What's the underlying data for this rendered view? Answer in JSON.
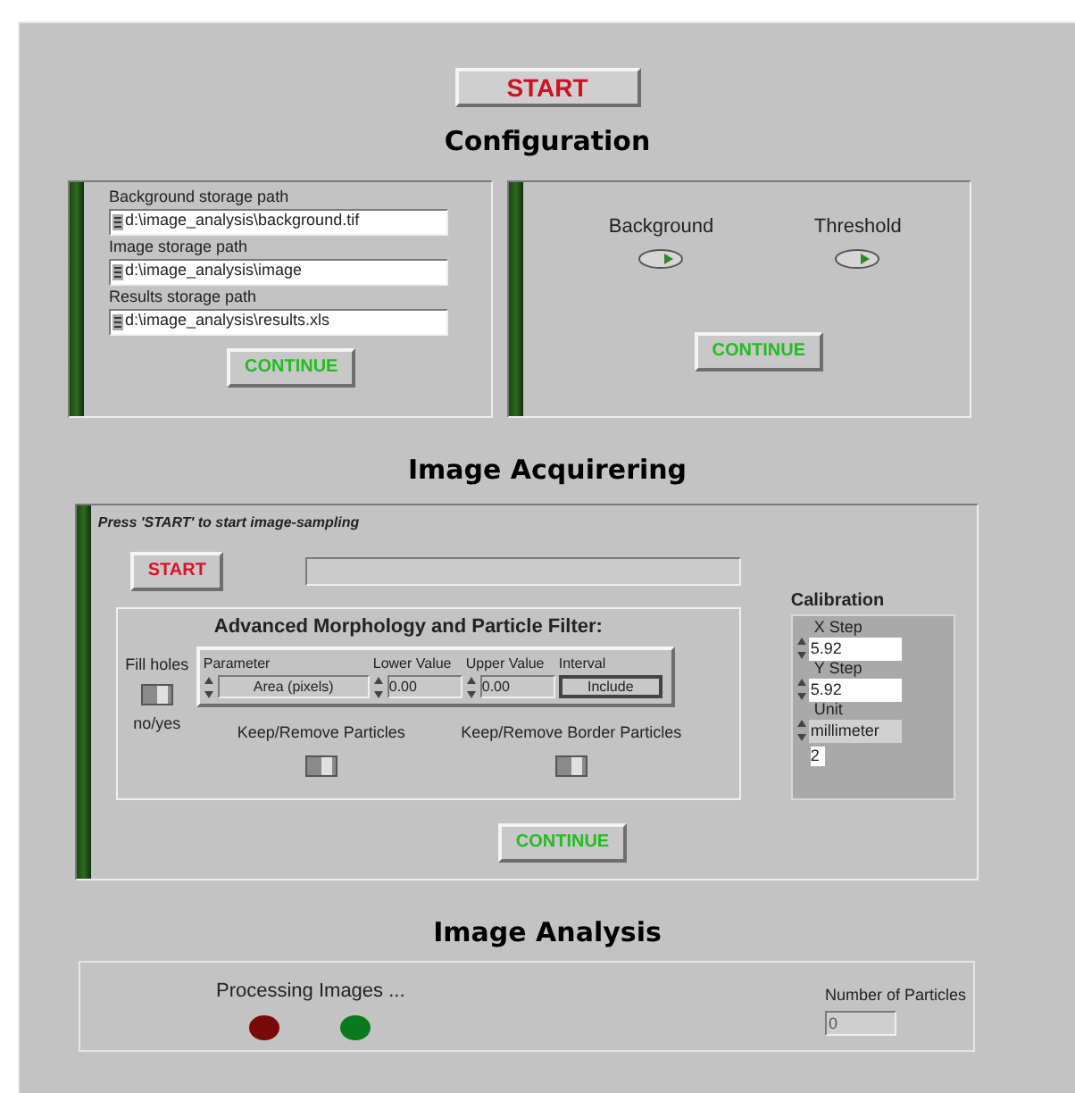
{
  "start_button": "START",
  "configuration": {
    "title": "Configuration",
    "paths": [
      {
        "label": "Background storage path",
        "value": "d:\\image_analysis\\background.tif"
      },
      {
        "label": "Image storage path",
        "value": "d:\\image_analysis\\image"
      },
      {
        "label": "Results storage path",
        "value": "d:\\image_analysis\\results.xls"
      }
    ],
    "continue_left": "CONTINUE",
    "toggles": [
      {
        "label": "Background"
      },
      {
        "label": "Threshold"
      }
    ],
    "continue_right": "CONTINUE"
  },
  "acquiring": {
    "title": "Image Acquirering",
    "hint": "Press 'START' to start image-sampling",
    "start": "START",
    "progress": {
      "level": 0
    },
    "filter": {
      "title": "Advanced Morphology and Particle Filter:",
      "fill_holes": "Fill holes",
      "fill_holes_caption": "no/yes",
      "columns": [
        "Parameter",
        "Lower Value",
        "Upper Value",
        "Interval"
      ],
      "parameter": "Area (pixels)",
      "lower": "0.00",
      "upper": "0.00",
      "interval": "Include",
      "switches": [
        {
          "label": "Keep/Remove Particles"
        },
        {
          "label": "Keep/Remove Border Particles"
        }
      ]
    },
    "calibration": {
      "title": "Calibration",
      "x_label": "X Step",
      "x_value": "5.92",
      "y_label": "Y Step",
      "y_value": "5.92",
      "unit_label": "Unit",
      "unit_value": "millimeter",
      "index": "2"
    },
    "continue": "CONTINUE"
  },
  "analysis": {
    "title": "Image Analysis",
    "processing": "Processing Images ...",
    "leds": [
      {
        "color": "#7a0a0a"
      },
      {
        "color": "#0a7a1e"
      }
    ],
    "particles_label": "Number of Particles",
    "particles_value": "0"
  }
}
